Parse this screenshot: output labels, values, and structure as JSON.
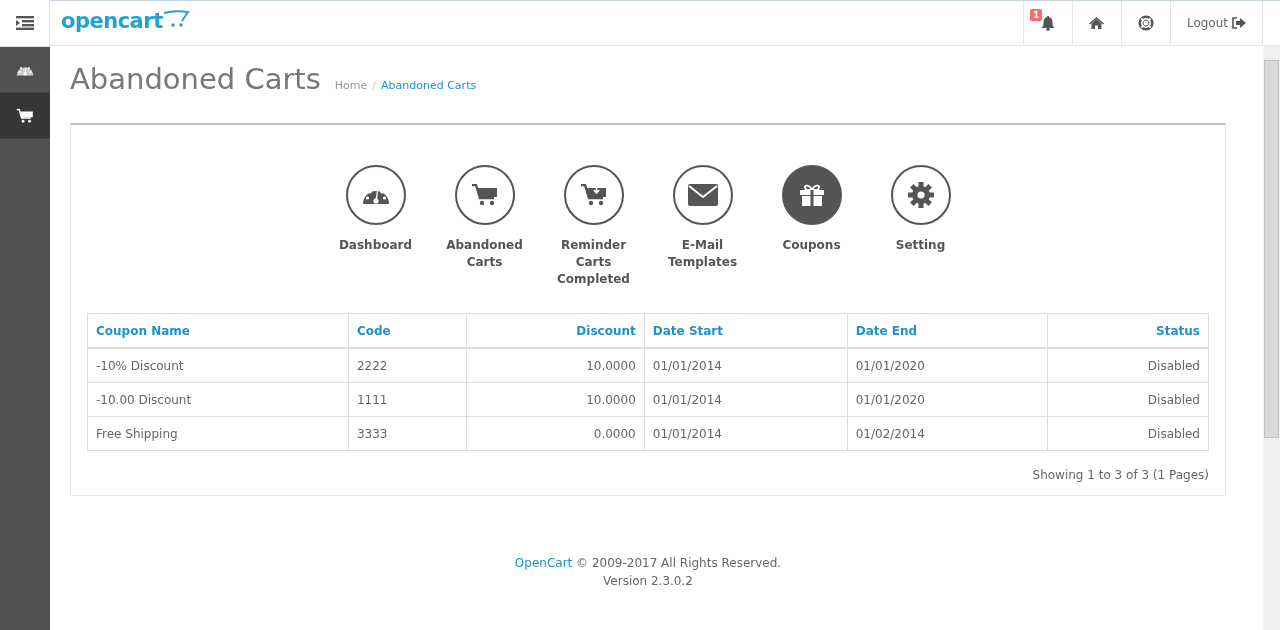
{
  "header": {
    "logo": "opencart",
    "notification_count": "1",
    "logout": "Logout"
  },
  "sidebar": {
    "items": [
      {
        "kind": "dashboard",
        "selected": false
      },
      {
        "kind": "cart",
        "selected": true
      }
    ]
  },
  "page": {
    "title": "Abandoned Carts",
    "breadcrumb_separator": "/",
    "breadcrumb": [
      {
        "label": "Home",
        "current": false
      },
      {
        "label": "Abandoned Carts",
        "current": true
      }
    ]
  },
  "tiles": [
    {
      "kind": "dashboard",
      "label": "Dashboard",
      "selected": false
    },
    {
      "kind": "cart",
      "label": "Abandoned Carts",
      "selected": false
    },
    {
      "kind": "cart-down",
      "label": "Reminder Carts Completed",
      "selected": false
    },
    {
      "kind": "mail",
      "label": "E-Mail Templates",
      "selected": false
    },
    {
      "kind": "gift",
      "label": "Coupons",
      "selected": true
    },
    {
      "kind": "gear",
      "label": "Setting",
      "selected": false
    }
  ],
  "table": {
    "columns": [
      "Coupon Name",
      "Code",
      "Discount",
      "Date Start",
      "Date End",
      "Status"
    ],
    "rows": [
      [
        "-10% Discount",
        "2222",
        "10.0000",
        "01/01/2014",
        "01/01/2020",
        "Disabled"
      ],
      [
        "-10.00 Discount",
        "1111",
        "10.0000",
        "01/01/2014",
        "01/01/2020",
        "Disabled"
      ],
      [
        "Free Shipping",
        "3333",
        "0.0000",
        "01/01/2014",
        "01/02/2014",
        "Disabled"
      ]
    ]
  },
  "pagination": "Showing 1 to 3 of 3 (1 Pages)",
  "footer": {
    "link": "OpenCart",
    "text": " © 2009-2017 All Rights Reserved.",
    "version": "Version 2.3.0.2"
  }
}
